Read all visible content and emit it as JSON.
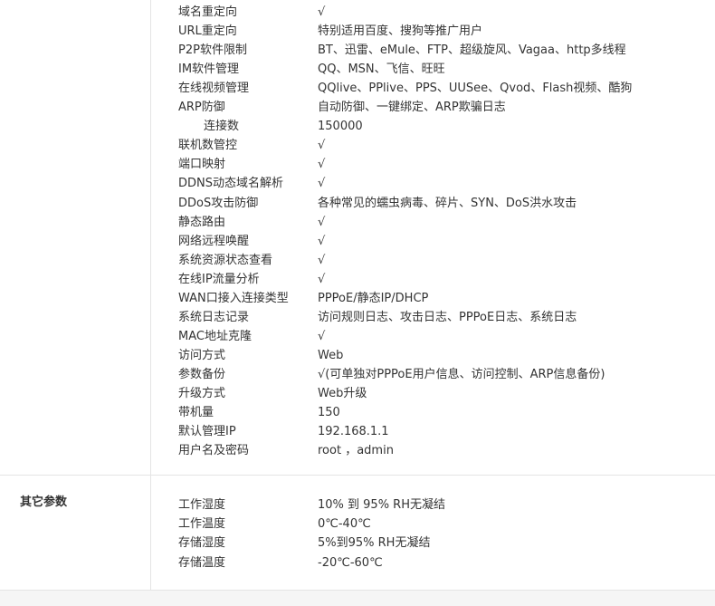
{
  "network_section": {
    "rows": [
      {
        "label": "域名重定向",
        "value": "√"
      },
      {
        "label": "URL重定向",
        "value": "特别适用百度、搜狗等推广用户"
      },
      {
        "label": "P2P软件限制",
        "value": "BT、迅雷、eMule、FTP、超级旋风、Vagaa、http多线程"
      },
      {
        "label": "IM软件管理",
        "value": "QQ、MSN、飞信、旺旺"
      },
      {
        "label": "在线视频管理",
        "value": "QQlive、PPlive、PPS、UUSee、Qvod、Flash视频、酷狗"
      },
      {
        "label": "ARP防御",
        "value": "自动防御、一键绑定、ARP欺骗日志"
      },
      {
        "label": "连接数",
        "value": "150000"
      },
      {
        "label": "联机数管控",
        "value": "√"
      },
      {
        "label": "端口映射",
        "value": "√"
      },
      {
        "label": "DDNS动态域名解析",
        "value": "√"
      },
      {
        "label": "DDoS攻击防御",
        "value": "各种常见的蠕虫病毒、碎片、SYN、DoS洪水攻击"
      },
      {
        "label": "静态路由",
        "value": "√"
      },
      {
        "label": "网络远程唤醒",
        "value": "√"
      },
      {
        "label": "系统资源状态查看",
        "value": "√"
      },
      {
        "label": "在线IP流量分析",
        "value": "√"
      },
      {
        "label": "WAN口接入连接类型",
        "value": "PPPoE/静态IP/DHCP"
      },
      {
        "label": "系统日志记录",
        "value": "访问规则日志、攻击日志、PPPoE日志、系统日志"
      },
      {
        "label": "MAC地址克隆",
        "value": "√"
      },
      {
        "label": "访问方式",
        "value": "Web"
      },
      {
        "label": "参数备份",
        "value": "√(可单独对PPPoE用户信息、访问控制、ARP信息备份)"
      },
      {
        "label": "升级方式",
        "value": "Web升级"
      },
      {
        "label": "带机量",
        "value": "150"
      },
      {
        "label": "默认管理IP",
        "value": "192.168.1.1"
      },
      {
        "label": "用户名及密码",
        "value": "root ，admin"
      }
    ]
  },
  "other_section": {
    "heading": "其它参数",
    "rows": [
      {
        "label": "工作湿度",
        "value": "10% 到 95% RH无凝结"
      },
      {
        "label": "工作温度",
        "value": "0℃-40℃"
      },
      {
        "label": "存储湿度",
        "value": "5%到95% RH无凝结"
      },
      {
        "label": "存储温度",
        "value": "-20℃-60℃"
      }
    ]
  }
}
